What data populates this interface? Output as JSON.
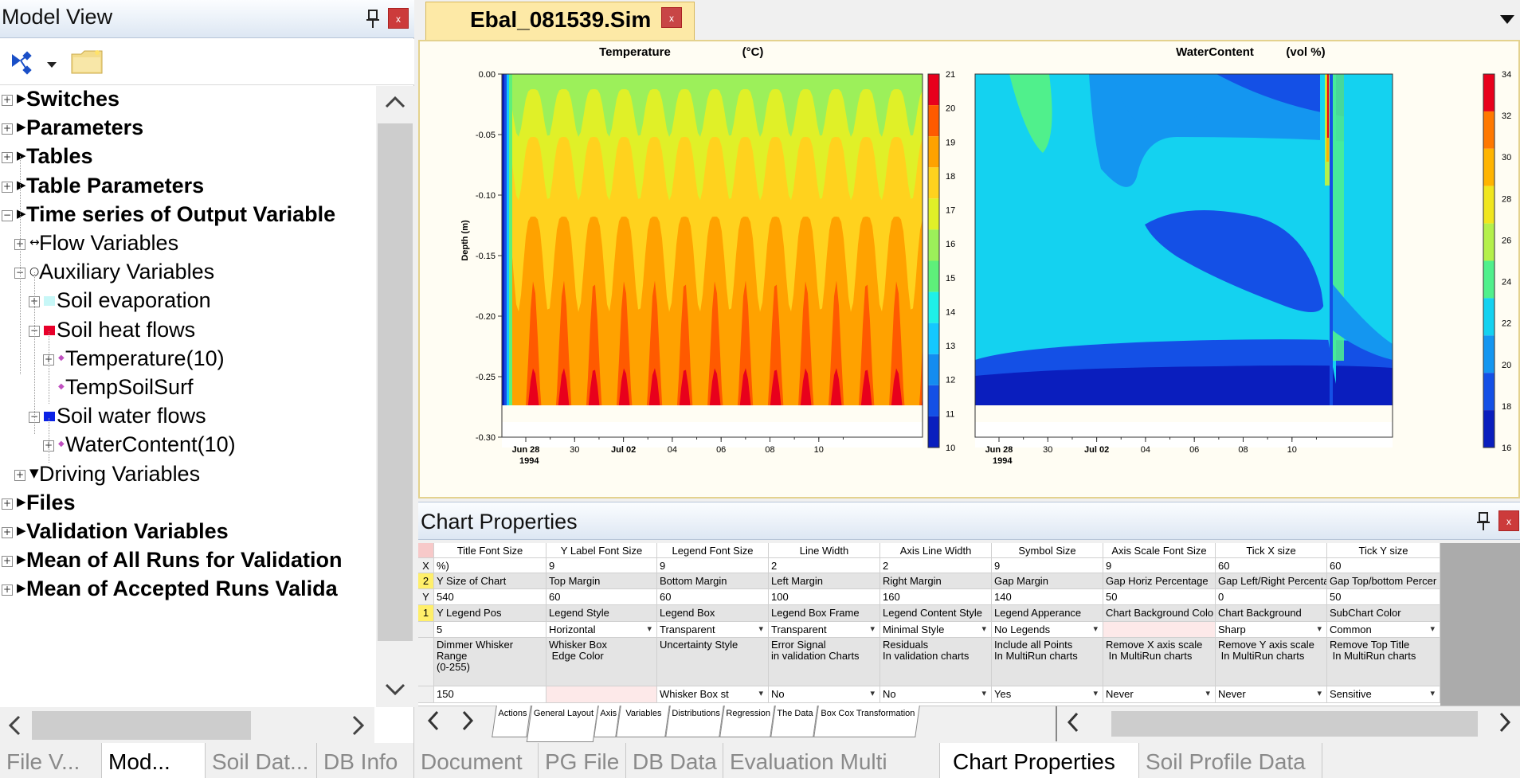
{
  "model_view": {
    "title": "Model View",
    "close_label": "x",
    "tree": [
      {
        "label": "Switches",
        "level": 0,
        "toggle": "+",
        "marker": "▶"
      },
      {
        "label": "Parameters",
        "level": 0,
        "toggle": "+",
        "marker": "▶"
      },
      {
        "label": "Tables",
        "level": 0,
        "toggle": "+",
        "marker": "▶"
      },
      {
        "label": "Table Parameters",
        "level": 0,
        "toggle": "+",
        "marker": "▶"
      },
      {
        "label": "Time series of Output Variable",
        "level": 0,
        "toggle": "−",
        "marker": "▶"
      },
      {
        "label": "Flow Variables",
        "level": 1,
        "toggle": "+",
        "marker": "↔"
      },
      {
        "label": "Auxiliary Variables",
        "level": 1,
        "toggle": "−",
        "marker": "○"
      },
      {
        "label": "Soil evaporation",
        "level": 2,
        "toggle": "+",
        "marker_color": "#c7f7f7"
      },
      {
        "label": "Soil heat flows",
        "level": 2,
        "toggle": "−",
        "marker_color": "#e8002a"
      },
      {
        "label": "Temperature(10)",
        "level": 3,
        "toggle": "+",
        "marker": "◆"
      },
      {
        "label": "TempSoilSurf",
        "level": 3,
        "toggle": "",
        "marker": "◆"
      },
      {
        "label": "Soil water flows",
        "level": 2,
        "toggle": "−",
        "marker_color": "#0b22e6"
      },
      {
        "label": "WaterContent(10)",
        "level": 3,
        "toggle": "+",
        "marker": "◆"
      },
      {
        "label": "Driving Variables",
        "level": 1,
        "toggle": "+",
        "marker": "▼"
      },
      {
        "label": "Files",
        "level": 0,
        "toggle": "+",
        "marker": "▶"
      },
      {
        "label": "Validation Variables",
        "level": 0,
        "toggle": "+",
        "marker": "▶"
      },
      {
        "label": "Mean of All Runs for Validation",
        "level": 0,
        "toggle": "+",
        "marker": "▶"
      },
      {
        "label": "Mean of Accepted Runs Valida",
        "level": 0,
        "toggle": "+",
        "marker": "▶"
      }
    ]
  },
  "left_tabs": [
    {
      "label": "File V...",
      "active": false
    },
    {
      "label": "Mod...",
      "active": true
    },
    {
      "label": "Soil Dat...",
      "active": false
    },
    {
      "label": "DB Info",
      "active": false
    }
  ],
  "document": {
    "title": "Ebal_081539.Sim",
    "close_label": "x"
  },
  "chart_data": [
    {
      "type": "heatmap",
      "title": "Temperature",
      "unit": "(°C)",
      "ylabel": "Depth (m)",
      "yticks": [
        "0.00",
        "-0.05",
        "-0.10",
        "-0.15",
        "-0.20",
        "-0.25",
        "-0.30"
      ],
      "ylim": [
        -0.3,
        0.0
      ],
      "xticks": [
        "Jun 28",
        "30",
        "Jul 02",
        "04",
        "06",
        "08",
        "10"
      ],
      "xticks_sub": [
        "1994",
        "",
        "",
        "",
        "",
        "",
        ""
      ],
      "colorbar_ticks": [
        "21",
        "20",
        "19",
        "18",
        "17",
        "16",
        "15",
        "14",
        "13",
        "12",
        "11",
        "10"
      ],
      "colorbar_colors": [
        "#e8001c",
        "#ff5a00",
        "#ffa200",
        "#ffd21e",
        "#e0f028",
        "#9cf05a",
        "#5ef07a",
        "#1ef0e8",
        "#14c8ff",
        "#148cf0",
        "#1450e6",
        "#0a1ebe"
      ]
    },
    {
      "type": "heatmap",
      "title": "WaterContent",
      "unit": "(vol %)",
      "xticks": [
        "Jun 28",
        "30",
        "Jul 02",
        "04",
        "06",
        "08",
        "10"
      ],
      "xticks_sub": [
        "1994",
        "",
        "",
        "",
        "",
        "",
        ""
      ],
      "colorbar_ticks": [
        "34",
        "32",
        "30",
        "28",
        "26",
        "24",
        "22",
        "20",
        "18",
        "16"
      ],
      "colorbar_colors": [
        "#e8001c",
        "#ff7800",
        "#ffb400",
        "#f0e61e",
        "#b4f04b",
        "#50f08c",
        "#14d2f0",
        "#1496f0",
        "#1450e6",
        "#0a1ebe"
      ]
    }
  ],
  "chart_properties": {
    "title": "Chart Properties",
    "close_label": "x",
    "row_headers": [
      "",
      "X",
      "2",
      "Y",
      "1",
      "",
      ""
    ],
    "rows": [
      [
        "Title Font Size",
        "Y Label Font Size",
        "Legend Font Size",
        "Line Width",
        "Axis Line Width",
        "Symbol Size",
        "Axis Scale Font Size",
        "Tick X size",
        "Tick Y size"
      ],
      [
        "%)",
        "9",
        "9",
        "2",
        "2",
        "9",
        "9",
        "60",
        "60"
      ],
      [
        "Y Size of Chart",
        "Top Margin",
        "Bottom Margin",
        "Left Margin",
        "Right Margin",
        "Gap Margin",
        "Gap Horiz Percentage",
        "Gap Left/Right Percenta",
        "Gap Top/bottom Percer"
      ],
      [
        "540",
        "60",
        "60",
        "100",
        "160",
        "140",
        "50",
        "0",
        "50"
      ],
      [
        "Y Legend Pos",
        "Legend Style",
        "Legend Box",
        "Legend Box Frame",
        "Legend Content Style",
        "Legend Apperance",
        "Chart Background Colo",
        "Chart Background",
        "SubChart Color"
      ],
      [
        "5",
        "Horizontal",
        "Transparent",
        "Transparent",
        "Minimal Style",
        "No Legends",
        "",
        "Sharp",
        "Common"
      ],
      [
        "Dimmer Whisker\nRange\n(0-255)",
        "Whisker Box\n Edge Color",
        "Uncertainty Style",
        "Error Signal\nin validation Charts",
        "Residuals\nIn validation charts",
        "Include all Points\nIn MultiRun charts",
        "Remove X axis scale\n In MultiRun charts",
        "Remove Y axis scale\n In MultiRun charts",
        "Remove Top Title\n In MultiRun charts"
      ],
      [
        "150",
        "",
        "Whisker Box st",
        "No",
        "No",
        "Yes",
        "Never",
        "Never",
        "Sensitive"
      ]
    ]
  },
  "sheet_tabs": [
    "Actions",
    "General Layout",
    "Axis",
    "Variables",
    "Distributions",
    "Regression",
    "The Data",
    "Box Cox Transformation"
  ],
  "bottom_tabs": [
    {
      "label": "Document",
      "active": false
    },
    {
      "label": "PG File",
      "active": false
    },
    {
      "label": "DB Data",
      "active": false
    },
    {
      "label": "Evaluation Multi",
      "active": false
    },
    {
      "label": "Chart Properties",
      "active": true
    },
    {
      "label": "Soil Profile Data",
      "active": false
    }
  ]
}
